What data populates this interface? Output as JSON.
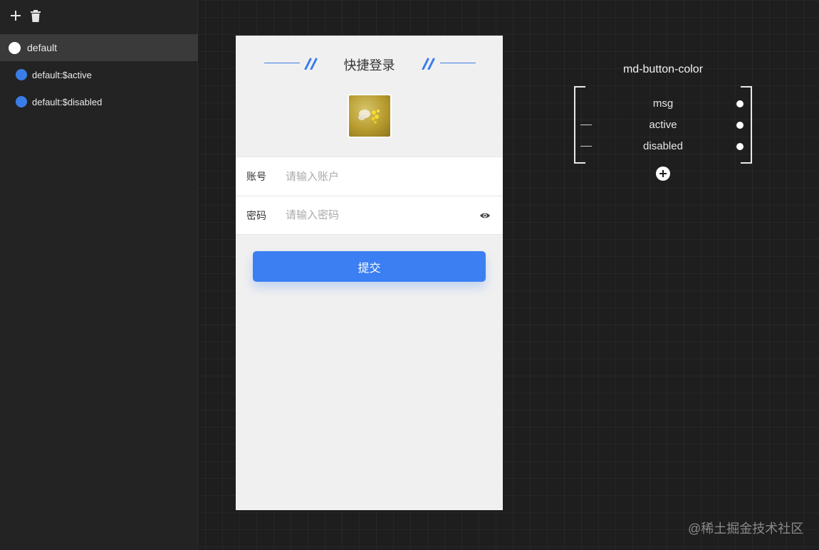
{
  "toolbar": {
    "add_icon": "plus-icon",
    "delete_icon": "trash-icon"
  },
  "states": [
    {
      "label": "default",
      "color": "#ffffff",
      "selected": true
    },
    {
      "label": "default:$active",
      "color": "#3a7de8",
      "selected": false
    },
    {
      "label": "default:$disabled",
      "color": "#3a7de8",
      "selected": false
    }
  ],
  "preview": {
    "title": "快捷登录",
    "account_label": "账号",
    "account_placeholder": "请输入账户",
    "password_label": "密码",
    "password_placeholder": "请输入密码",
    "submit_label": "提交",
    "accent": "#3b7ff3"
  },
  "property": {
    "name": "md-button-color",
    "rows": [
      "msg",
      "active",
      "disabled"
    ]
  },
  "watermark": "@稀土掘金技术社区"
}
